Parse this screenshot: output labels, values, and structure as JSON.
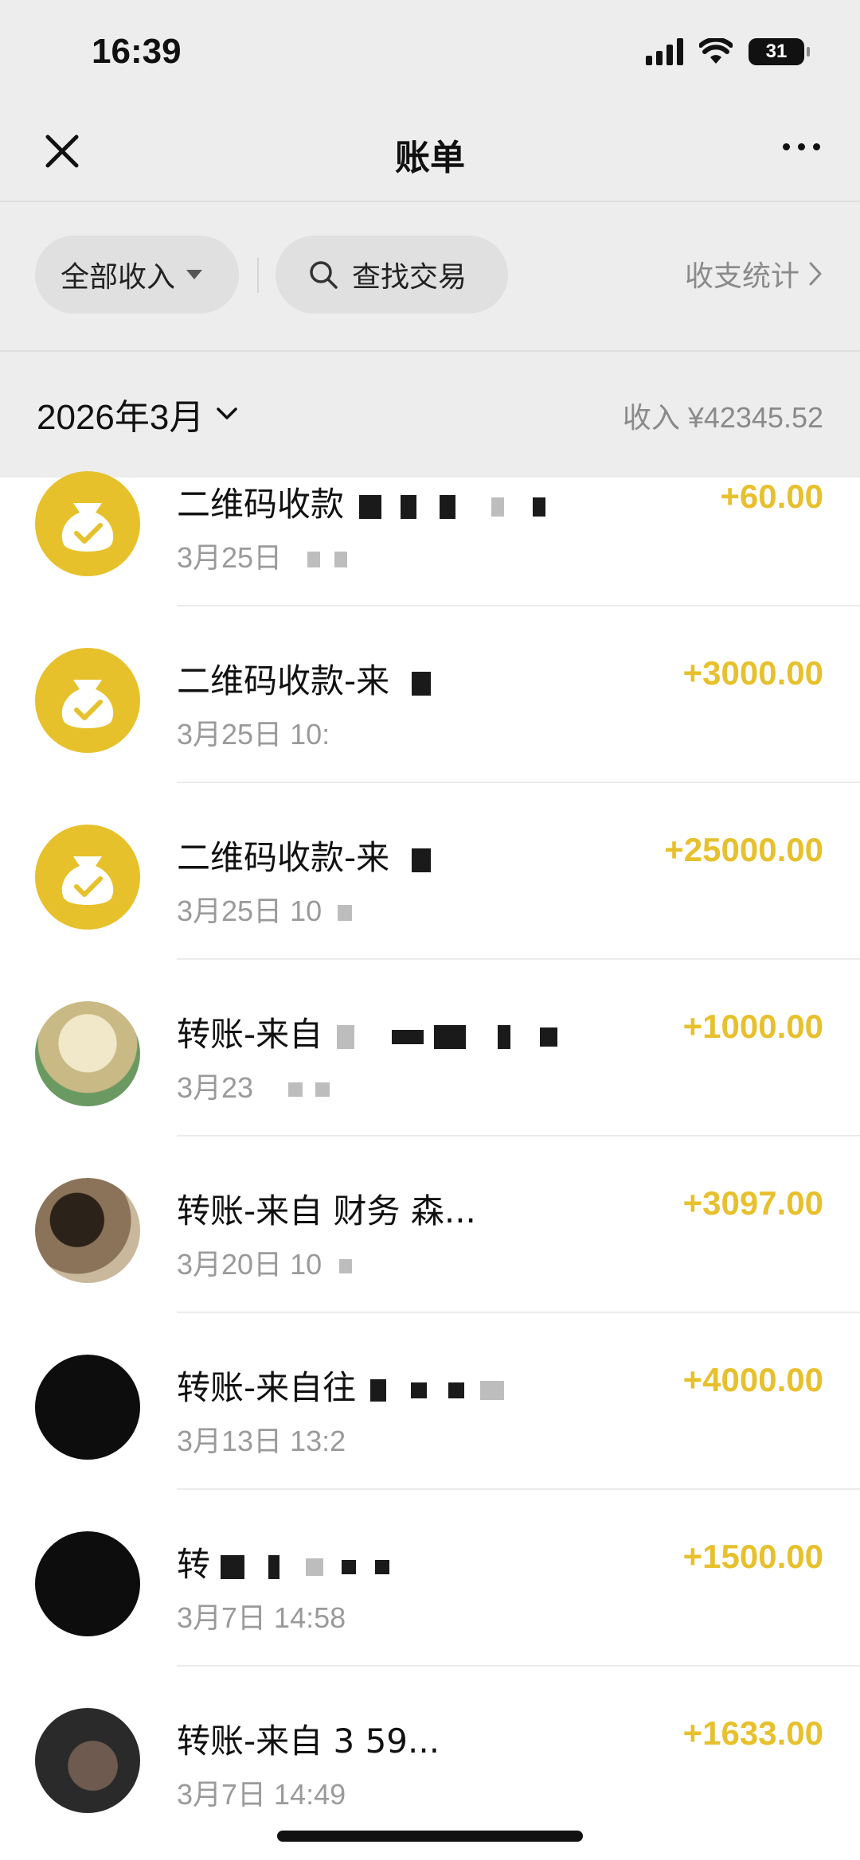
{
  "status_bar": {
    "time": "16:39",
    "battery": "31"
  },
  "nav": {
    "title": "账单"
  },
  "filters": {
    "income_filter": "全部收入",
    "search_label": "查找交易",
    "stats_label": "收支统计"
  },
  "month": {
    "selected": "2026年3月",
    "total": "收入 ¥42345.52"
  },
  "colors": {
    "amount": "#e7c02d",
    "icon_gold": "#e6c12b"
  },
  "transactions": [
    {
      "title": "二维码收款",
      "time": "3月25日",
      "amount": "+60.00",
      "icon": "money-bag-icon"
    },
    {
      "title": "二维码收款-来",
      "time": "3月25日 10:",
      "amount": "+3000.00",
      "icon": "money-bag-icon"
    },
    {
      "title": "二维码收款-来",
      "time": "3月25日 10",
      "amount": "+25000.00",
      "icon": "money-bag-icon"
    },
    {
      "title": "转账-来自",
      "time": "3月23",
      "amount": "+1000.00",
      "icon": "avatar"
    },
    {
      "title": "转账-来自 财务 森...",
      "time": "3月20日 10",
      "amount": "+3097.00",
      "icon": "avatar"
    },
    {
      "title": "转账-来自往",
      "time": "3月13日 13:2",
      "amount": "+4000.00",
      "icon": "avatar"
    },
    {
      "title": "转",
      "time": "3月7日 14:58",
      "amount": "+1500.00",
      "icon": "avatar"
    },
    {
      "title": "转账-来自 3 59...",
      "time": "3月7日 14:49",
      "amount": "+1633.00",
      "icon": "avatar"
    }
  ]
}
